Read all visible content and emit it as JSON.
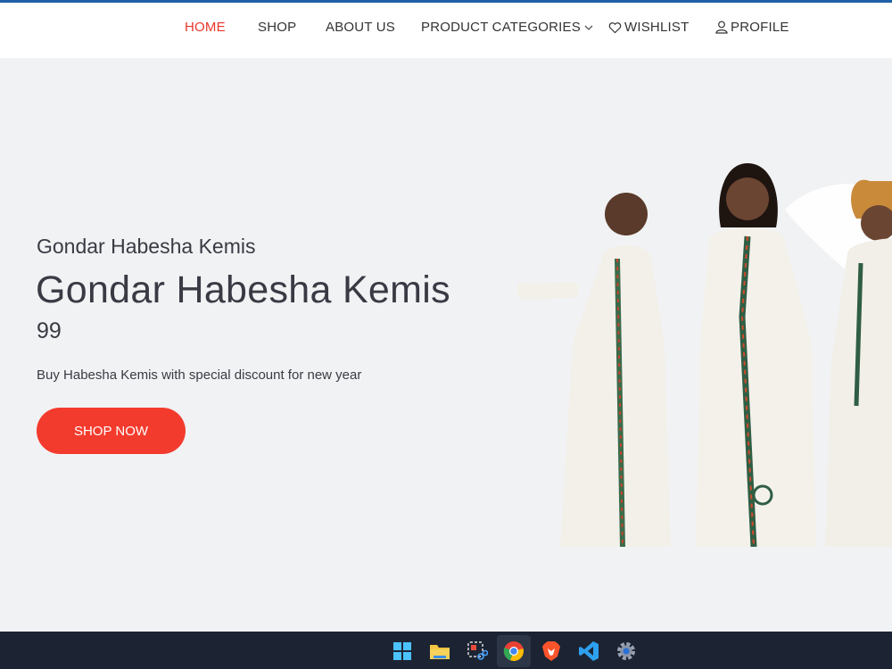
{
  "nav": {
    "home": "HOME",
    "shop": "SHOP",
    "about": "ABOUT US",
    "categories": "PRODUCT CATEGORIES",
    "wishlist": "WISHLIST",
    "profile": "PROFILE",
    "active_color": "#e8372b"
  },
  "hero": {
    "subtitle": "Gondar Habesha Kemis",
    "title": "Gondar Habesha Kemis",
    "price": "99",
    "description": "Buy Habesha Kemis with special discount for new year",
    "cta": "SHOP NOW",
    "cta_color": "#f33b2d"
  },
  "taskbar": {
    "icons": [
      "windows-start-icon",
      "file-explorer-icon",
      "snipping-tool-icon",
      "chrome-icon",
      "brave-icon",
      "vscode-icon",
      "settings-icon"
    ]
  }
}
